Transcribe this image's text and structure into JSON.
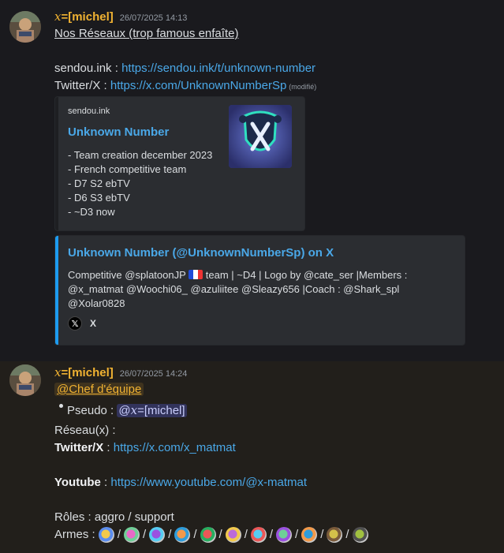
{
  "messages": [
    {
      "username_prefix": "x",
      "username_rest": "=[michel]",
      "timestamp": "26/07/2025 14:13",
      "title_line": "Nos Réseaux (trop famous enfaîte)",
      "sendou_label": "sendou.ink : ",
      "sendou_link": "https://sendou.ink/t/unknown-number",
      "twitter_label": "Twitter/X : ",
      "twitter_link": "https://x.com/UnknownNumberSp",
      "edited": "(modifié)",
      "embed1": {
        "provider": "sendou.ink",
        "title": "Unknown Number",
        "lines": [
          "- Team creation december 2023",
          "- French competitive team",
          "- D7 S2 ebTV",
          "- D6 S3 ebTV",
          "- ~D3 now"
        ],
        "bar_color": "#1e1f22"
      },
      "embed2": {
        "title": "Unknown Number (@UnknownNumberSp) on X",
        "desc_line1_a": "Competitive @splatoonJP ",
        "desc_line1_b": " team | ~D4 | Logo by @cate_ser |Members :",
        "desc_line2": "@x_matmat @Woochi06_ @azuliitee @Sleazy656 |Coach : @Shark_spl",
        "desc_line3": "@Xolar0828",
        "footer": "X",
        "bar_color": "#1d9bf0"
      }
    },
    {
      "username_prefix": "x",
      "username_rest": "=[michel]",
      "timestamp": "26/07/2025 14:24",
      "role_mention": "@Chef d'équipe",
      "pseudo_label": "Pseudo : ",
      "user_mention_prefix": "@",
      "user_mention_x": "x",
      "user_mention_rest": "=[michel]",
      "reseau_label": "Réseau(x) :",
      "twitter_label": "Twitter/X",
      "twitter_sep": " : ",
      "twitter_link": "https://x.com/x_matmat",
      "youtube_label": "Youtube",
      "youtube_sep": " : ",
      "youtube_link": "https://www.youtube.com/@x-matmat",
      "roles_line": "Rôles : aggro / support",
      "armes_label": "Armes : ",
      "weapon_separator": "/",
      "weapons": [
        "weapon-1",
        "weapon-2",
        "weapon-3",
        "weapon-4",
        "weapon-5",
        "weapon-6",
        "weapon-7",
        "weapon-8",
        "weapon-9",
        "weapon-10",
        "weapon-11"
      ]
    }
  ],
  "colors": {
    "username": "#f0b232",
    "link": "#4aa8e8",
    "x_brand": "#1d9bf0",
    "background": "#1a1a1e",
    "highlight_background": "#221f1b"
  }
}
